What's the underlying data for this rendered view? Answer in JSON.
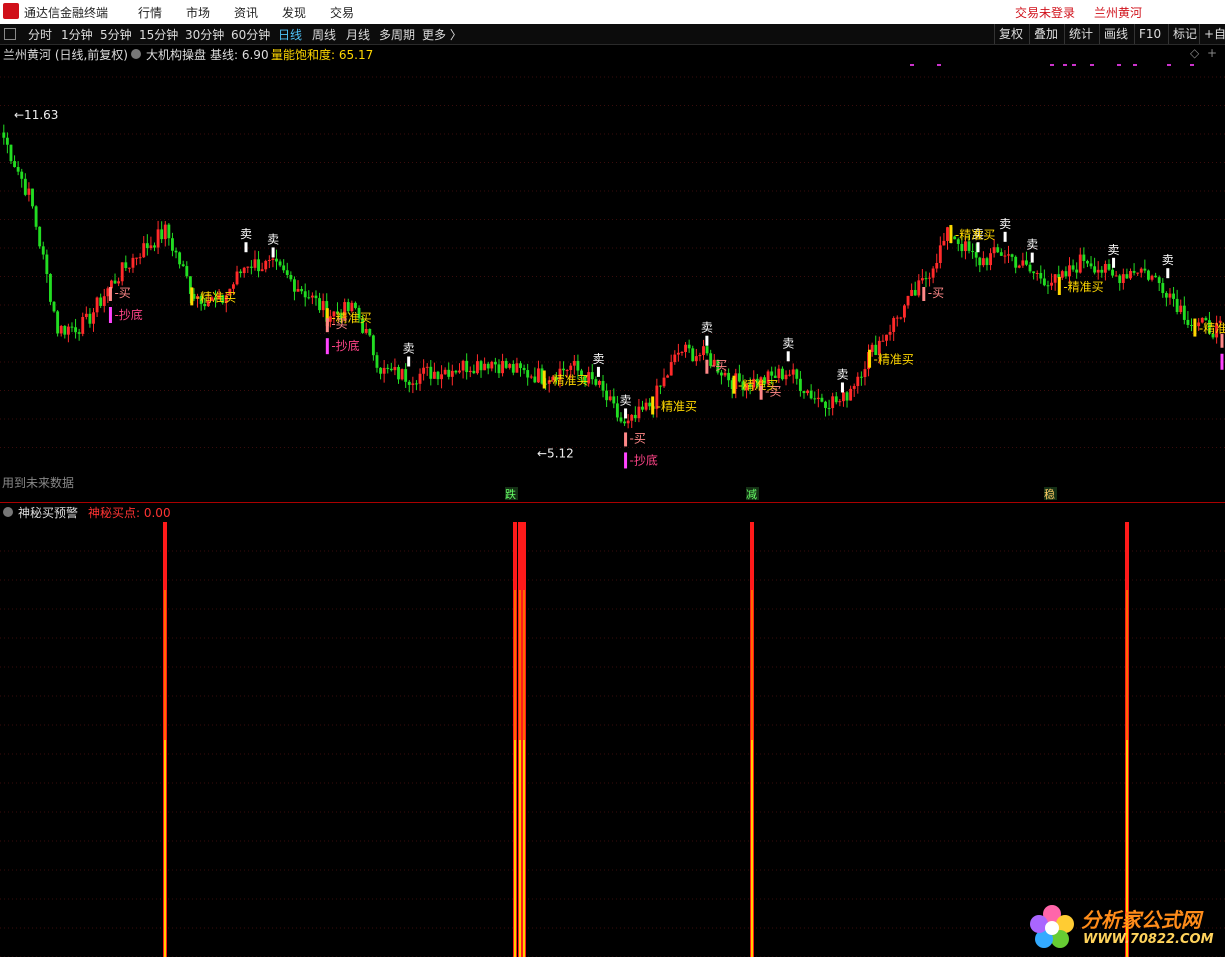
{
  "app": {
    "title": "通达信金融终端",
    "menu": [
      "行情",
      "市场",
      "资讯",
      "发现",
      "交易"
    ],
    "right_status": "交易未登录",
    "right_stock": "兰州黄河"
  },
  "toolbar": {
    "periods": [
      "分时",
      "1分钟",
      "5分钟",
      "15分钟",
      "30分钟",
      "60分钟",
      "日线",
      "周线",
      "月线",
      "多周期",
      "更多 〉"
    ],
    "active_period": "日线",
    "tools": [
      "复权",
      "叠加",
      "统计",
      "画线",
      "F10",
      "标记",
      "+自"
    ]
  },
  "info": {
    "stock": "兰州黄河 (日线,前复权)",
    "indicator": "大机构操盘",
    "base_label": "基线: 6.90",
    "saturation": "量能饱和度: 65.17"
  },
  "main": {
    "high_label": "11.63",
    "low_label": "5.12",
    "future_data": "用到未来数据",
    "sell_label": "卖",
    "precise_buy_label": "精准买",
    "buy_label": "买",
    "bottom_label": "抄底",
    "bottom_markers": [
      "跌",
      "减",
      "稳"
    ]
  },
  "sub": {
    "title": "神秘买预警",
    "value": "神秘买点: 0.00"
  },
  "colors": {
    "up": "#ff2a2a",
    "down": "#22dd22",
    "precise": "#ffd700",
    "buy": "#ff8888",
    "bottom": "#ff44ff",
    "signal": "#ff1a1a"
  },
  "chart_data": {
    "type": "line",
    "title": "兰州黄河 (日线,前复权)",
    "series": [
      {
        "name": "兰州黄河",
        "values": [
          11.2,
          10.0,
          7.5,
          7.6,
          8.4,
          9.0,
          9.4,
          8.2,
          8.0,
          8.8,
          8.7,
          8.3,
          7.8,
          7.9,
          6.7,
          6.6,
          6.7,
          6.8,
          6.9,
          6.7,
          6.6,
          6.8,
          6.4,
          5.6,
          6.1,
          7.1,
          7.0,
          6.5,
          6.5,
          6.7,
          6.2,
          6.1,
          7.0,
          7.7,
          8.4,
          9.4,
          8.8,
          9.0,
          8.6,
          8.4,
          8.9,
          8.5,
          8.7,
          8.3,
          7.6,
          7.5
        ]
      }
    ],
    "ylim": [
      4.8,
      12.0
    ],
    "annotations": [
      "11.63",
      "5.12"
    ]
  }
}
